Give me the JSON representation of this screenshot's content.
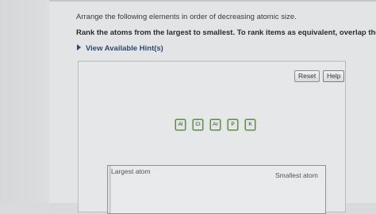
{
  "question": {
    "prompt": "Arrange the following elements in order of decreasing atomic size.",
    "instruction": "Rank the atoms from the largest to smallest. To rank items as equivalent, overlap them.",
    "hints_link": "View Available Hint(s)"
  },
  "controls": {
    "reset_label": "Reset",
    "help_label": "Help"
  },
  "tiles": [
    "Al",
    "Cl",
    "Ar",
    "P",
    "K"
  ],
  "ranking": {
    "left_label": "Largest atom",
    "right_label": "Smallest atom"
  }
}
